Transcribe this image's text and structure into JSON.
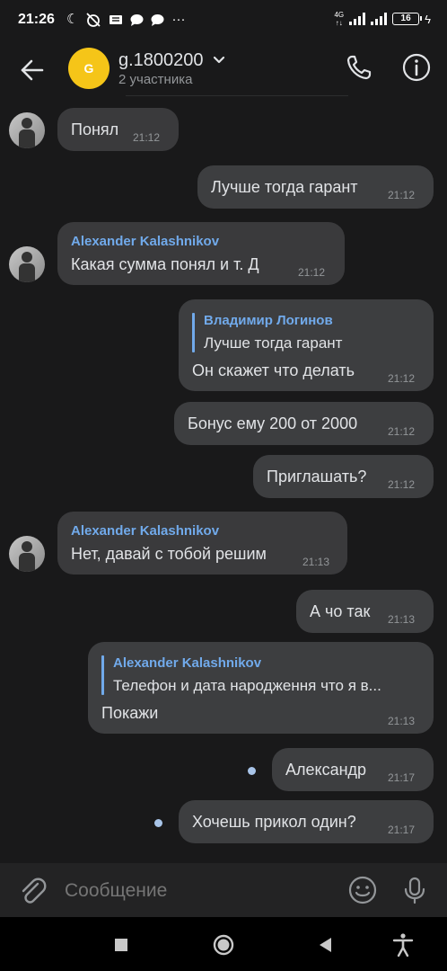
{
  "status_bar": {
    "time": "21:26",
    "icons": [
      "moon-icon",
      "alarm-off-icon",
      "mail-icon",
      "chat-icon",
      "chat-icon",
      "more-icon"
    ],
    "network_label": "4G",
    "battery": "16"
  },
  "header": {
    "avatar_letter": "G",
    "title": "g.1800200",
    "subtitle": "2 участника",
    "accent_color": "#f5c518"
  },
  "messages": [
    {
      "direction": "in",
      "text": "Понял",
      "time": "21:12"
    },
    {
      "direction": "out",
      "text": "Лучше тогда гарант",
      "time": "21:12"
    },
    {
      "direction": "in",
      "sender": "Alexander Kalashnikov",
      "text": "Какая сумма понял и т. Д",
      "time": "21:12"
    },
    {
      "direction": "out",
      "reply_name": "Владимир Логинов",
      "reply_text": "Лучше тогда гарант",
      "text": "Он скажет что делать",
      "time": "21:12"
    },
    {
      "direction": "out",
      "text": "Бонус ему 200 от 2000",
      "time": "21:12"
    },
    {
      "direction": "out",
      "text": "Приглашать?",
      "time": "21:12"
    },
    {
      "direction": "in",
      "sender": "Alexander Kalashnikov",
      "text": "Нет, давай с тобой решим",
      "time": "21:13"
    },
    {
      "direction": "out",
      "text": "А чо так",
      "time": "21:13"
    },
    {
      "direction": "out",
      "reply_name": "Alexander Kalashnikov",
      "reply_text": "Телефон и дата народження что я в...",
      "text": "Покажи",
      "time": "21:13"
    },
    {
      "direction": "out",
      "text": "Александр",
      "time": "21:17",
      "unread": true
    },
    {
      "direction": "out",
      "text": "Хочешь прикол один?",
      "time": "21:17",
      "unread": true
    }
  ],
  "composer": {
    "placeholder": "Сообщение"
  },
  "colors": {
    "background": "#19191a",
    "bubble": "#3a3a3c",
    "link": "#71aaeb",
    "muted": "#939699"
  }
}
